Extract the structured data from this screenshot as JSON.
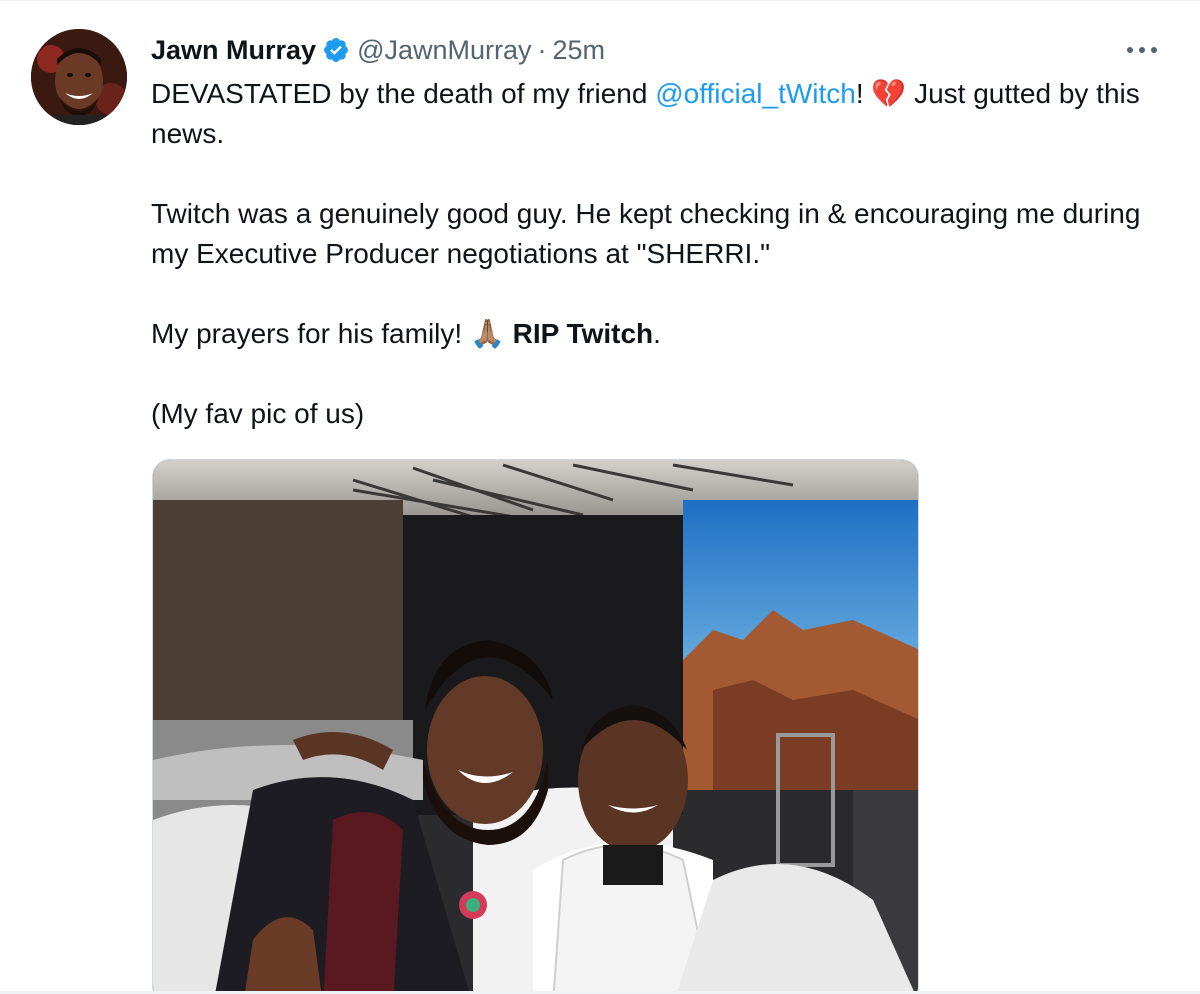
{
  "author": {
    "name": "Jawn Murray",
    "handle": "@JawnMurray",
    "separator": "·",
    "time": "25m",
    "verified_icon": "verified-badge-icon",
    "avatar_icon": "profile-avatar"
  },
  "more_icon": "more-options-icon",
  "tweet": {
    "line1_prefix": "DEVASTATED by the death of my friend ",
    "mention": "@official_tWitch",
    "line1_after_mention": "! ",
    "broken_heart_emoji": "💔",
    "line1_suffix": " Just gutted by this news.",
    "para2": "Twitch was a genuinely good guy. He kept checking in & encouraging me during my Executive Producer negotiations at \"SHERRI.\"",
    "para3_prefix": "My prayers for his family! ",
    "pray_emoji": "🙏🏽",
    "para3_bold": " RIP Twitch",
    "para3_suffix": ".",
    "para4": "(My fav pic of us)"
  },
  "colors": {
    "text": "#0f1419",
    "secondary": "#536471",
    "link": "#1d9bf0",
    "verified": "#1d9bf0"
  }
}
